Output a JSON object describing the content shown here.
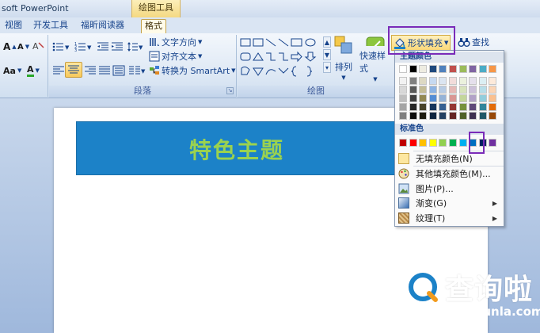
{
  "titlebar": {
    "app_title": "soft PowerPoint",
    "tools_tab": "绘图工具"
  },
  "tabs": [
    "视图",
    "开发工具",
    "福昕阅读器",
    "格式"
  ],
  "font_group": {
    "grow_icon": "A",
    "shrink_icon": "A",
    "font_color_icon": "A",
    "case_label": "Aa"
  },
  "paragraph_group": {
    "label": "段落",
    "text_direction": "文字方向",
    "align_text": "对齐文本",
    "convert_smartart": "转换为 SmartArt"
  },
  "drawing_group": {
    "label": "绘图",
    "arrange": "排列",
    "quick_styles": "快速样式",
    "shape_fill": "形状填充",
    "find": "查找"
  },
  "slide": {
    "title": "特色主题"
  },
  "dropdown": {
    "theme_colors_label": "主题颜色",
    "standard_colors_label": "标准色",
    "no_fill": "无填充颜色(N)",
    "more_colors": "其他填充颜色(M)...",
    "picture": "图片(P)...",
    "gradient": "渐变(G)",
    "texture": "纹理(T)",
    "theme_top_row": [
      "#ffffff",
      "#000000",
      "#eeece1",
      "#1f497d",
      "#4f81bd",
      "#c0504d",
      "#9bbb59",
      "#8064a2",
      "#4bacc6",
      "#f79646"
    ],
    "theme_tints": [
      [
        "#f2f2f2",
        "#7f7f7f",
        "#ddd9c3",
        "#c6d9f0",
        "#dbe5f1",
        "#f2dcdb",
        "#ebf1dd",
        "#e5e0ec",
        "#dbeef3",
        "#fdeada"
      ],
      [
        "#d8d8d8",
        "#595959",
        "#c4bd97",
        "#8db3e2",
        "#b8cce4",
        "#e5b9b7",
        "#d7e3bc",
        "#ccc1d9",
        "#b7dde8",
        "#fbd5b5"
      ],
      [
        "#bfbfbf",
        "#3f3f3f",
        "#938953",
        "#548dd4",
        "#95b3d7",
        "#d99694",
        "#c3d69b",
        "#b2a2c7",
        "#92cddc",
        "#fac08f"
      ],
      [
        "#a5a5a5",
        "#262626",
        "#494429",
        "#17365d",
        "#366092",
        "#953734",
        "#76923c",
        "#5f497a",
        "#31859b",
        "#e36c09"
      ],
      [
        "#7f7f7f",
        "#0c0c0c",
        "#1d1b10",
        "#0f243e",
        "#244061",
        "#632423",
        "#4f6128",
        "#3f3151",
        "#205867",
        "#974806"
      ]
    ],
    "standard_colors": [
      "#c00000",
      "#ff0000",
      "#ffc000",
      "#ffff00",
      "#92d050",
      "#00b050",
      "#00b0f0",
      "#0070c0",
      "#002060",
      "#7030a0"
    ]
  },
  "watermark": {
    "brand": "查询啦",
    "url": "chaxunla.com"
  }
}
